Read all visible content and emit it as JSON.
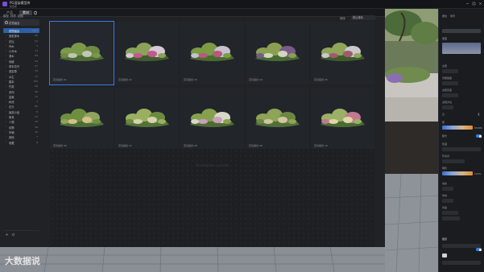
{
  "app": {
    "title": "PG渲染模型库",
    "subtitle": "模型库"
  },
  "panel": {
    "tabs": [
      {
        "label": "产品"
      },
      {
        "label": "素材"
      }
    ]
  },
  "sidebar": {
    "header_tabs": [
      "模型",
      "材质",
      "贴图"
    ],
    "search_text": "花境组合",
    "items": [
      {
        "label": "花境组合",
        "count": "1984",
        "selected": true
      },
      {
        "label": "造型灌木",
        "count": "65"
      },
      {
        "label": "花坛",
        "count": "22"
      },
      {
        "label": "乔木",
        "count": "2"
      },
      {
        "label": "小乔木",
        "count": "14"
      },
      {
        "label": "灌木",
        "count": "83"
      },
      {
        "label": "地被",
        "count": "54"
      },
      {
        "label": "草本花卉",
        "count": "57"
      },
      {
        "label": "观赏草",
        "count": "33"
      },
      {
        "label": "水生",
        "count": "17"
      },
      {
        "label": "藤本",
        "count": "154"
      },
      {
        "label": "竹类",
        "count": "26"
      },
      {
        "label": "多肉",
        "count": "26"
      },
      {
        "label": "盆栽",
        "count": "11"
      },
      {
        "label": "树池",
        "count": "1"
      },
      {
        "label": "石头",
        "count": "80"
      },
      {
        "label": "景观小品",
        "count": "8"
      },
      {
        "label": "家具",
        "count": "52"
      },
      {
        "label": "人物",
        "count": "10"
      },
      {
        "label": "动物",
        "count": "16"
      },
      {
        "label": "车辆",
        "count": "20"
      },
      {
        "label": "其他",
        "count": "7"
      },
      {
        "label": "收藏",
        "count": "8"
      }
    ]
  },
  "filter": {
    "label": "排序",
    "value": "默认排序"
  },
  "tiles": [
    {
      "name": "花境组合 01"
    },
    {
      "name": "花境组合 02"
    },
    {
      "name": "花境组合 03"
    },
    {
      "name": "花境组合 04"
    },
    {
      "name": "花境组合 05"
    },
    {
      "name": "花境组合 06"
    },
    {
      "name": "花境组合 07"
    },
    {
      "name": "花境组合 08"
    },
    {
      "name": "花境组合 09"
    },
    {
      "name": "花境组合 10"
    }
  ],
  "empty_area": {
    "text": "Marketplace content"
  },
  "watermark": {
    "text": "大数据说"
  },
  "right_panel": {
    "tabs": [
      "属性",
      "场景"
    ],
    "section_label": "天空",
    "labels": [
      "太阳",
      "光照强度",
      "太阳高度",
      "太阳方位",
      "云",
      "雾",
      "曝光",
      "色温",
      "环境光",
      "阴影",
      "动态",
      "风向",
      "风速"
    ],
    "values": [
      "100%",
      "6500K",
      "50%",
      "0",
      "1.0"
    ],
    "bottom_section": "图层"
  }
}
